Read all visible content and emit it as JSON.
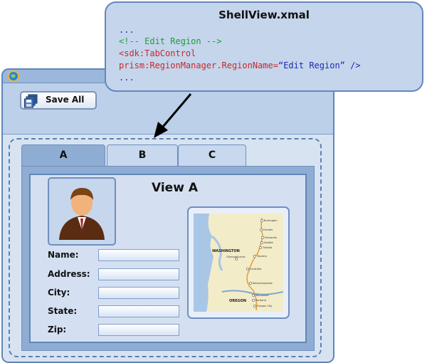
{
  "shell": {
    "toolbar": {
      "save_all_label": "Save All"
    },
    "tabs": [
      {
        "label": "A",
        "selected": true
      },
      {
        "label": "B",
        "selected": false
      },
      {
        "label": "C",
        "selected": false
      }
    ],
    "view": {
      "title": "View A",
      "form": [
        {
          "label": "Name:",
          "value": ""
        },
        {
          "label": "Address:",
          "value": ""
        },
        {
          "label": "City:",
          "value": ""
        },
        {
          "label": "State:",
          "value": ""
        },
        {
          "label": "Zip:",
          "value": ""
        }
      ],
      "map": {
        "regions": [
          "WASHINGTON",
          "OREGON"
        ],
        "cities": [
          "Burlington",
          "Everett",
          "Edmonds",
          "Seattle",
          "Tukwila",
          "Olympia/Lacey",
          "Tacoma",
          "Centralia",
          "Kelso/Longview",
          "Vancouver",
          "Portland",
          "Oregon City"
        ]
      }
    }
  },
  "callout": {
    "title": "ShellView.xmal",
    "code": {
      "line1": "...",
      "line2": "<!-- Edit Region -->",
      "line3": "<sdk:TabControl",
      "line4_attr": "prism:RegionManager.RegionName=",
      "line4_value": "“Edit Region” />",
      "line5": "..."
    }
  },
  "colors": {
    "shell_border": "#5f86b8",
    "code_comment": "#1aa035",
    "code_tag": "#c8282a",
    "code_value": "#1b2bb0"
  }
}
